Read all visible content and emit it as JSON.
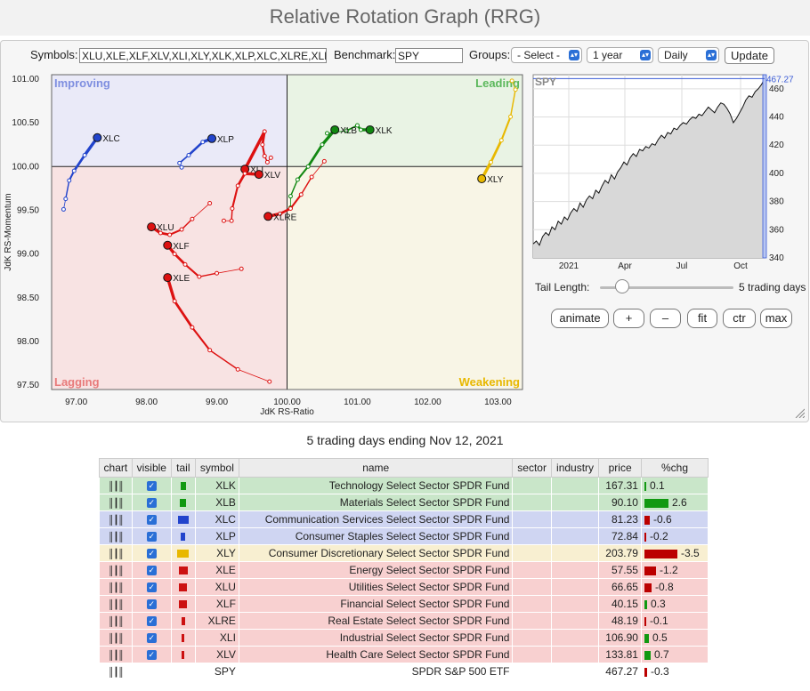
{
  "page_title": "Relative Rotation Graph (RRG)",
  "controls": {
    "symbols_label": "Symbols:",
    "symbols_value": "XLU,XLE,XLF,XLV,XLI,XLY,XLK,XLP,XLC,XLRE,XLB",
    "benchmark_label": "Benchmark:",
    "benchmark_value": "SPY",
    "groups_label": "Groups:",
    "groups_value": "- Select -",
    "period_value": "1 year",
    "frequency_value": "Daily",
    "update_label": "Update"
  },
  "chart_data": {
    "type": "scatter",
    "xlabel": "JdK RS-Ratio",
    "ylabel": "JdK RS-Momentum",
    "xlim": [
      96.65,
      103.35
    ],
    "ylim": [
      97.45,
      101.05
    ],
    "xticks": [
      "97.00",
      "98.00",
      "99.00",
      "100.00",
      "101.00",
      "102.00",
      "103.00"
    ],
    "yticks": [
      "101.00",
      "100.50",
      "100.00",
      "99.50",
      "99.00",
      "98.50",
      "98.00",
      "97.50"
    ],
    "quadrants": {
      "improving": "Improving",
      "leading": "Leading",
      "lagging": "Lagging",
      "weakening": "Weakening"
    },
    "series": [
      {
        "name": "XLC",
        "color": "#2244cc",
        "points": [
          [
            96.82,
            99.51
          ],
          [
            96.85,
            99.63
          ],
          [
            96.9,
            99.84
          ],
          [
            96.97,
            99.95
          ],
          [
            97.12,
            100.13
          ],
          [
            97.3,
            100.33
          ]
        ]
      },
      {
        "name": "XLP",
        "color": "#2244cc",
        "points": [
          [
            98.5,
            99.99
          ],
          [
            98.47,
            100.04
          ],
          [
            98.6,
            100.13
          ],
          [
            98.8,
            100.28
          ],
          [
            98.93,
            100.32
          ]
        ]
      },
      {
        "name": "XLK",
        "color": "#118811",
        "points": [
          [
            100.57,
            100.38
          ],
          [
            100.85,
            100.41
          ],
          [
            101.0,
            100.47
          ],
          [
            101.05,
            100.42
          ],
          [
            101.18,
            100.42
          ]
        ]
      },
      {
        "name": "XLB",
        "color": "#118811",
        "points": [
          [
            100.05,
            99.53
          ],
          [
            100.05,
            99.66
          ],
          [
            100.15,
            99.85
          ],
          [
            100.3,
            100.0
          ],
          [
            100.5,
            100.25
          ],
          [
            100.68,
            100.42
          ]
        ]
      },
      {
        "name": "XLY",
        "color": "#e8b800",
        "points": [
          [
            103.2,
            100.98
          ],
          [
            103.25,
            100.88
          ],
          [
            103.18,
            100.57
          ],
          [
            103.05,
            100.3
          ],
          [
            102.9,
            100.05
          ],
          [
            102.77,
            99.86
          ]
        ]
      },
      {
        "name": "XLE",
        "color": "#dd1111",
        "points": [
          [
            99.75,
            97.54
          ],
          [
            99.3,
            97.68
          ],
          [
            98.9,
            97.9
          ],
          [
            98.65,
            98.16
          ],
          [
            98.4,
            98.46
          ],
          [
            98.3,
            98.73
          ]
        ]
      },
      {
        "name": "XLU",
        "color": "#dd1111",
        "points": [
          [
            98.9,
            99.58
          ],
          [
            98.65,
            99.4
          ],
          [
            98.5,
            99.28
          ],
          [
            98.33,
            99.22
          ],
          [
            98.2,
            99.24
          ],
          [
            98.07,
            99.31
          ]
        ]
      },
      {
        "name": "XLF",
        "color": "#dd1111",
        "points": [
          [
            99.35,
            98.83
          ],
          [
            99.0,
            98.78
          ],
          [
            98.75,
            98.74
          ],
          [
            98.55,
            98.88
          ],
          [
            98.4,
            99.0
          ],
          [
            98.3,
            99.1
          ]
        ]
      },
      {
        "name": "XLRE",
        "color": "#dd1111",
        "points": [
          [
            100.53,
            100.06
          ],
          [
            100.35,
            99.88
          ],
          [
            100.2,
            99.68
          ],
          [
            100.05,
            99.52
          ],
          [
            99.9,
            99.46
          ],
          [
            99.73,
            99.43
          ]
        ]
      },
      {
        "name": "XLI",
        "color": "#dd1111",
        "points": [
          [
            99.77,
            100.1
          ],
          [
            99.72,
            100.05
          ],
          [
            99.68,
            100.12
          ],
          [
            99.65,
            100.25
          ],
          [
            99.68,
            100.4
          ],
          [
            99.4,
            99.97
          ]
        ]
      },
      {
        "name": "XLV",
        "color": "#dd1111",
        "points": [
          [
            99.1,
            99.38
          ],
          [
            99.21,
            99.38
          ],
          [
            99.22,
            99.52
          ],
          [
            99.3,
            99.78
          ],
          [
            99.4,
            99.92
          ],
          [
            99.6,
            99.91
          ]
        ]
      }
    ]
  },
  "price_chart": {
    "symbol": "SPY",
    "last_label": "467.27",
    "last_value": 467.27,
    "ylim": [
      340,
      470
    ],
    "yticks": [
      "460",
      "440",
      "420",
      "400",
      "380",
      "360",
      "340"
    ],
    "xticks": [
      "2021",
      "Apr",
      "Jul",
      "Oct"
    ],
    "values": [
      350,
      352,
      349,
      355,
      358,
      356,
      362,
      360,
      366,
      364,
      369,
      367,
      372,
      375,
      373,
      379,
      376,
      381,
      384,
      382,
      388,
      386,
      391,
      395,
      393,
      399,
      396,
      401,
      404,
      408,
      406,
      411,
      414,
      412,
      417,
      416,
      419,
      418,
      421,
      420,
      424,
      427,
      425,
      429,
      428,
      432,
      431,
      434,
      436,
      435,
      438,
      440,
      439,
      442,
      441,
      444,
      447,
      445,
      443,
      447,
      450,
      449,
      446,
      442,
      436,
      439,
      443,
      447,
      452,
      455,
      454,
      458,
      460,
      463,
      467.27
    ]
  },
  "tail": {
    "label": "Tail Length:",
    "value": 5,
    "max": 25,
    "value_label": "5 trading days"
  },
  "buttons": {
    "animate": "animate",
    "plus": "+",
    "minus": "–",
    "fit": "fit",
    "ctr": "ctr",
    "max": "max"
  },
  "table": {
    "subtitle": "5 trading days ending Nov 12, 2021",
    "headers": [
      "chart",
      "visible",
      "tail",
      "symbol",
      "name",
      "sector",
      "industry",
      "price",
      "%chg"
    ],
    "rows": [
      {
        "symbol": "XLK",
        "name": "Technology Select Sector SPDR Fund",
        "price": "167.31",
        "chg": "0.1",
        "chg_value": 0.1,
        "bg": "#c9e6c9",
        "tail_color": "#119911",
        "tail_width": 6,
        "visible": true
      },
      {
        "symbol": "XLB",
        "name": "Materials Select Sector SPDR Fund",
        "price": "90.10",
        "chg": "2.6",
        "chg_value": 2.6,
        "bg": "#c9e6c9",
        "tail_color": "#119911",
        "tail_width": 7,
        "visible": true
      },
      {
        "symbol": "XLC",
        "name": "Communication Services Select Sector SPDR Fund",
        "price": "81.23",
        "chg": "-0.6",
        "chg_value": -0.6,
        "bg": "#cfd5f2",
        "tail_color": "#2244cc",
        "tail_width": 12,
        "visible": true
      },
      {
        "symbol": "XLP",
        "name": "Consumer Staples Select Sector SPDR Fund",
        "price": "72.84",
        "chg": "-0.2",
        "chg_value": -0.2,
        "bg": "#cfd5f2",
        "tail_color": "#2244cc",
        "tail_width": 5,
        "visible": true
      },
      {
        "symbol": "XLY",
        "name": "Consumer Discretionary Select Sector SPDR Fund",
        "price": "203.79",
        "chg": "-3.5",
        "chg_value": -3.5,
        "bg": "#f8efd1",
        "tail_color": "#e8b800",
        "tail_width": 13,
        "visible": true
      },
      {
        "symbol": "XLE",
        "name": "Energy Select Sector SPDR Fund",
        "price": "57.55",
        "chg": "-1.2",
        "chg_value": -1.2,
        "bg": "#f8d0d0",
        "tail_color": "#cc1111",
        "tail_width": 10,
        "visible": true
      },
      {
        "symbol": "XLU",
        "name": "Utilities Select Sector SPDR Fund",
        "price": "66.65",
        "chg": "-0.8",
        "chg_value": -0.8,
        "bg": "#f8d0d0",
        "tail_color": "#cc1111",
        "tail_width": 9,
        "visible": true
      },
      {
        "symbol": "XLF",
        "name": "Financial Select Sector SPDR Fund",
        "price": "40.15",
        "chg": "0.3",
        "chg_value": 0.3,
        "bg": "#f8d0d0",
        "tail_color": "#cc1111",
        "tail_width": 9,
        "visible": true
      },
      {
        "symbol": "XLRE",
        "name": "Real Estate Select Sector SPDR Fund",
        "price": "48.19",
        "chg": "-0.1",
        "chg_value": -0.1,
        "bg": "#f8d0d0",
        "tail_color": "#cc1111",
        "tail_width": 4,
        "visible": true
      },
      {
        "symbol": "XLI",
        "name": "Industrial Select Sector SPDR Fund",
        "price": "106.90",
        "chg": "0.5",
        "chg_value": 0.5,
        "bg": "#f8d0d0",
        "tail_color": "#cc1111",
        "tail_width": 3,
        "visible": true
      },
      {
        "symbol": "XLV",
        "name": "Health Care Select Sector SPDR Fund",
        "price": "133.81",
        "chg": "0.7",
        "chg_value": 0.7,
        "bg": "#f8d0d0",
        "tail_color": "#cc1111",
        "tail_width": 3,
        "visible": true
      },
      {
        "symbol": "SPY",
        "name": "SPDR S&P 500 ETF",
        "price": "467.27",
        "chg": "-0.3",
        "chg_value": -0.3,
        "bg": "#ffffff",
        "tail_color": "",
        "tail_width": 0,
        "visible": false
      }
    ]
  }
}
